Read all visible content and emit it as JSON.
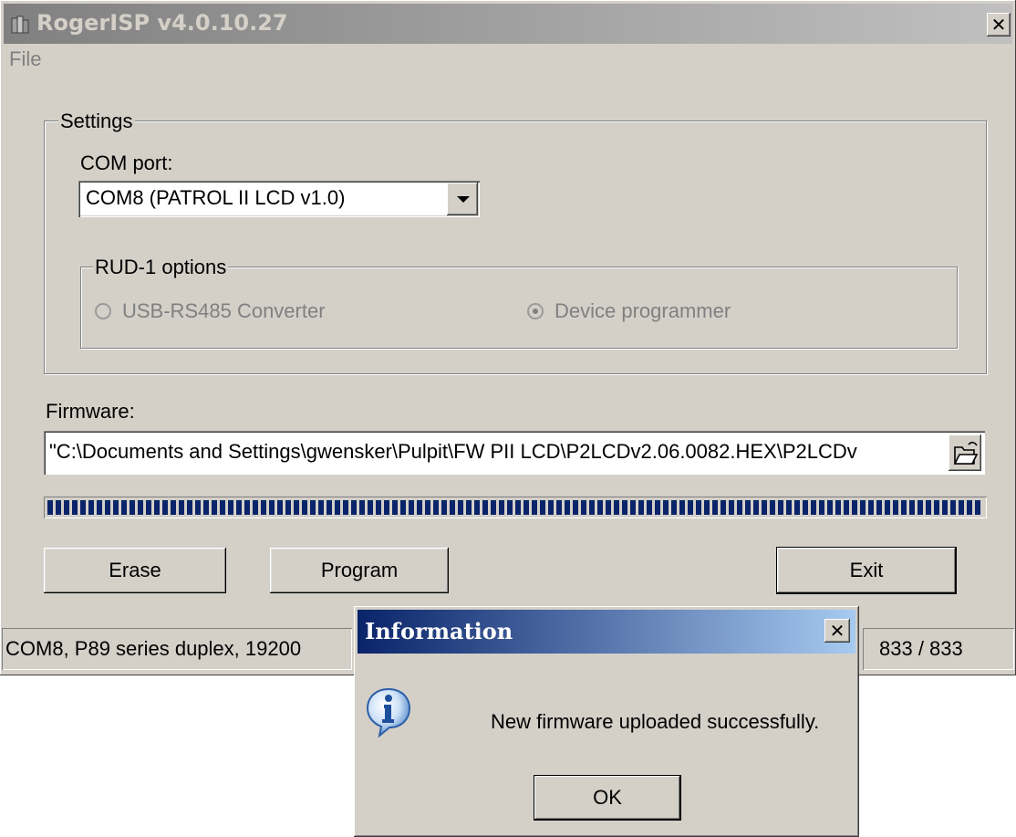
{
  "window": {
    "title": "RogerISP v4.0.10.27",
    "close_label": "✕"
  },
  "menu": {
    "file": "File"
  },
  "settings": {
    "legend": "Settings",
    "com_port_label": "COM port:",
    "com_port_value": "COM8 (PATROL II LCD v1.0)",
    "rud_legend": "RUD-1 options",
    "radio_converter": "USB-RS485 Converter",
    "radio_programmer": "Device programmer",
    "selected_option": "Device programmer"
  },
  "firmware": {
    "label": "Firmware:",
    "path": "\"C:\\Documents and Settings\\gwensker\\Pulpit\\FW PII LCD\\P2LCDv2.06.0082.HEX\\P2LCDv",
    "progress_fraction": 1.0
  },
  "buttons": {
    "erase": "Erase",
    "program": "Program",
    "exit": "Exit"
  },
  "status": {
    "connection": "COM8, P89 series duplex, 19200",
    "count": "833 / 833"
  },
  "dialog": {
    "title": "Information",
    "close_label": "✕",
    "message": "New firmware uploaded successfully.",
    "ok": "OK"
  },
  "icons": [
    "app-icon",
    "folder-open-icon",
    "info-icon",
    "chevron-down-icon",
    "close-icon"
  ]
}
